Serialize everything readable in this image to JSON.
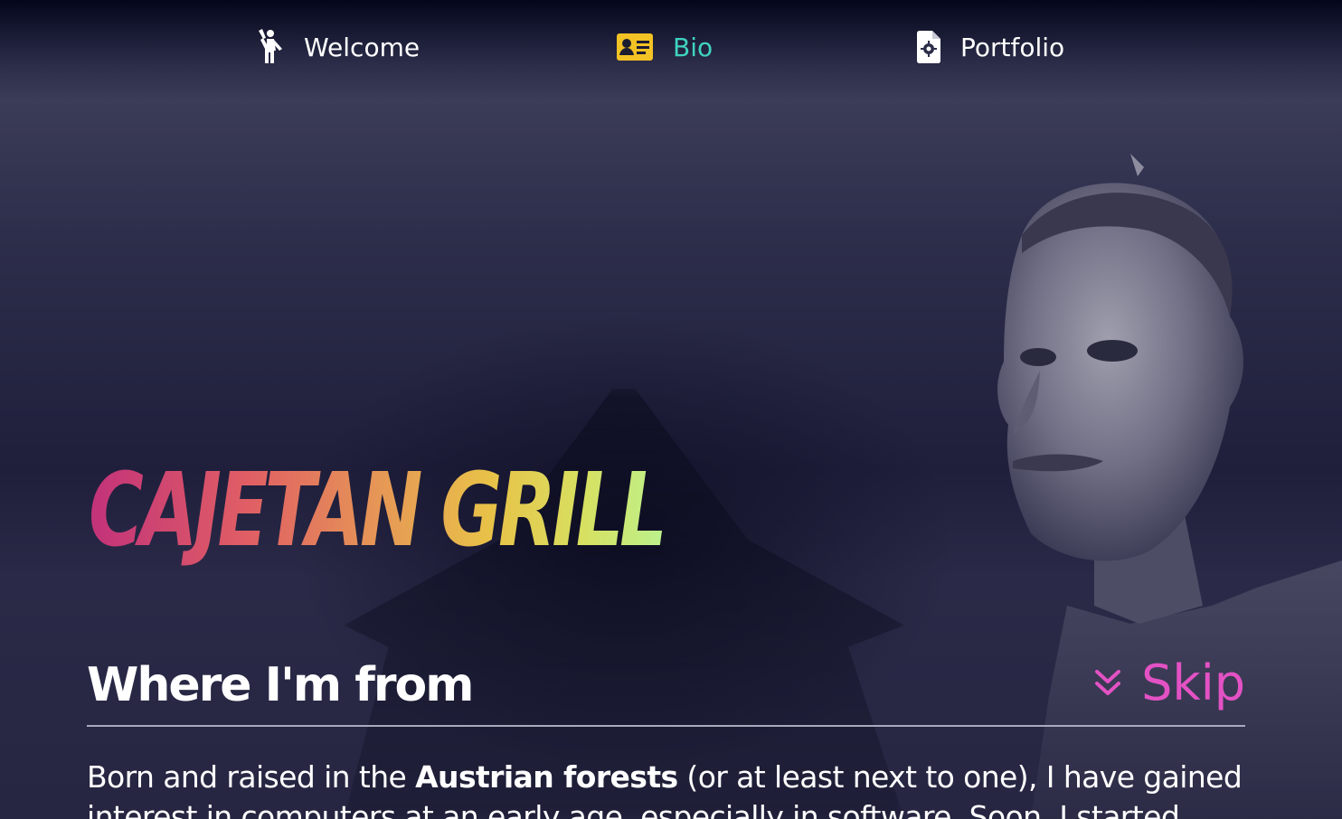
{
  "nav": {
    "items": [
      {
        "label": "Welcome",
        "icon": "person-waving-icon",
        "active": false
      },
      {
        "label": "Bio",
        "icon": "id-card-icon",
        "active": true
      },
      {
        "label": "Portfolio",
        "icon": "file-code-icon",
        "active": false
      }
    ]
  },
  "hero": {
    "name": "CAJETAN GRILL"
  },
  "section": {
    "heading": "Where I'm from",
    "skip_label": "Skip",
    "skip_icon": "double-chevron-down-icon",
    "paragraph_before": "Born and raised in the ",
    "paragraph_bold": "Austrian forests",
    "paragraph_after": " (or at least next to one), I have gained interest in computers at an early age, especially in software. Soon, I started"
  },
  "colors": {
    "active_nav": "#3fd3c0",
    "id_card": "#f3c224",
    "skip": "#e352c4",
    "name_gradient": [
      "#c2327a",
      "#e69b55",
      "#e8c248",
      "#bcf18c"
    ]
  }
}
